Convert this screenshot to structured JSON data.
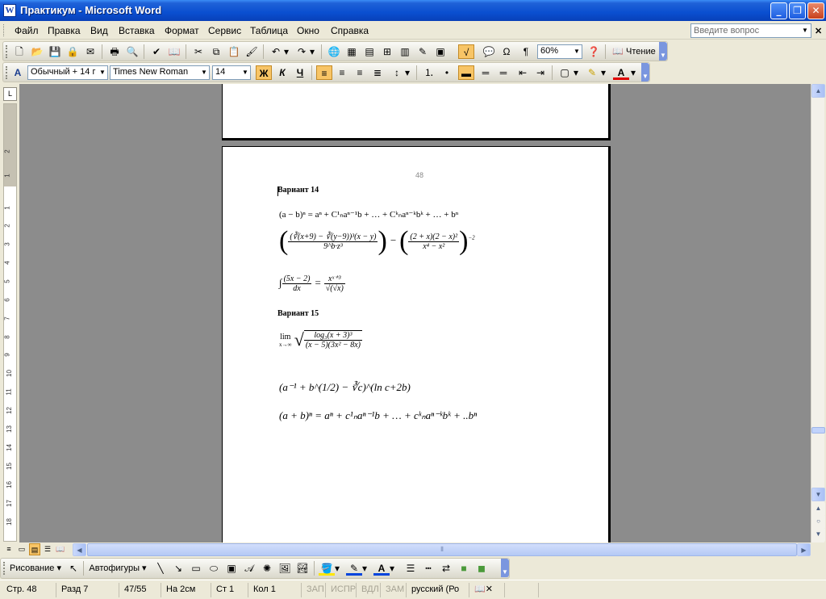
{
  "window": {
    "title": "Практикум - Microsoft Word",
    "app_icon": "W",
    "btn_min": "_",
    "btn_max": "❐",
    "btn_close": "✕"
  },
  "menu": {
    "items": [
      "Файл",
      "Правка",
      "Вид",
      "Вставка",
      "Формат",
      "Сервис",
      "Таблица",
      "Окно",
      "Справка"
    ],
    "help_placeholder": "Введите вопрос",
    "close_doc": "✕"
  },
  "toolbar_standard": {
    "zoom": "60%",
    "reading_label": "Чтение"
  },
  "toolbar_formatting": {
    "style": "Обычный + 14 г",
    "font": "Times New Roman",
    "size": "14",
    "bold": "Ж",
    "italic": "К",
    "underline": "Ч"
  },
  "ruler": {
    "h_ticks": [
      "2",
      "1",
      "1",
      "2",
      "3",
      "4",
      "5",
      "6",
      "7",
      "8",
      "9",
      "10",
      "11",
      "12",
      "13",
      "14",
      "15",
      "16",
      "17"
    ],
    "v_ticks": [
      "2",
      "1",
      "1",
      "2",
      "3",
      "4",
      "5",
      "6",
      "7",
      "8",
      "9",
      "10",
      "11",
      "12",
      "13",
      "14",
      "15",
      "16",
      "17",
      "18"
    ]
  },
  "document": {
    "page_number": "48",
    "heading_14": "Вариант  14",
    "heading_15": "Вариант  15",
    "f1": "(a − b)ⁿ = aⁿ + C¹ₙaⁿ⁻¹b + … + Cᵏₙaⁿ⁻ᵏbᵏ + … + bⁿ",
    "f2_num_left": "(∛(x+9) − ∛(y−9))³(x − y)",
    "f2_den_left": "9^b·z³",
    "f2_minus": "−",
    "f2_num_right": "(2 + x)(2 − x)²",
    "f2_den_right": "x⁴ − x²",
    "f2_exp": "−2",
    "f3_int": "∫",
    "f3_num": "(5x − 2)",
    "f3_den": "dx",
    "f3_eq": "=",
    "f3_rnum": "xˣ⁺³",
    "f3_rden": "√(√x)",
    "f4_lim": "lim",
    "f4_sub": "x→∞",
    "f4_num": "log₃(x + 3)³",
    "f4_den": "(x − 5)(3x² − 8x)",
    "f5": "(a⁻¹ + b^(1/2) − ∛c)^(ln c+2b)",
    "f6": "(a + b)ⁿ = aⁿ + c¹ₙaⁿ⁻¹b + … + cᵏₙaⁿ⁻ᵏbᵏ + ..bⁿ"
  },
  "drawing": {
    "draw_label": "Рисование",
    "autoshapes_label": "Автофигуры"
  },
  "status": {
    "page": "Стр.  48",
    "section": "Разд  7",
    "pages": "47/55",
    "at": "На  2см",
    "line": "Ст  1",
    "col": "Кол  1",
    "rec": "ЗАП",
    "trk": "ИСПР",
    "ext": "ВДЛ",
    "ovr": "ЗАМ",
    "lang": "русский (Ро"
  },
  "colors": {
    "titlebar": "#0a4fd0",
    "doc_background": "#8c8c8c",
    "active_button": "#f8c566"
  }
}
